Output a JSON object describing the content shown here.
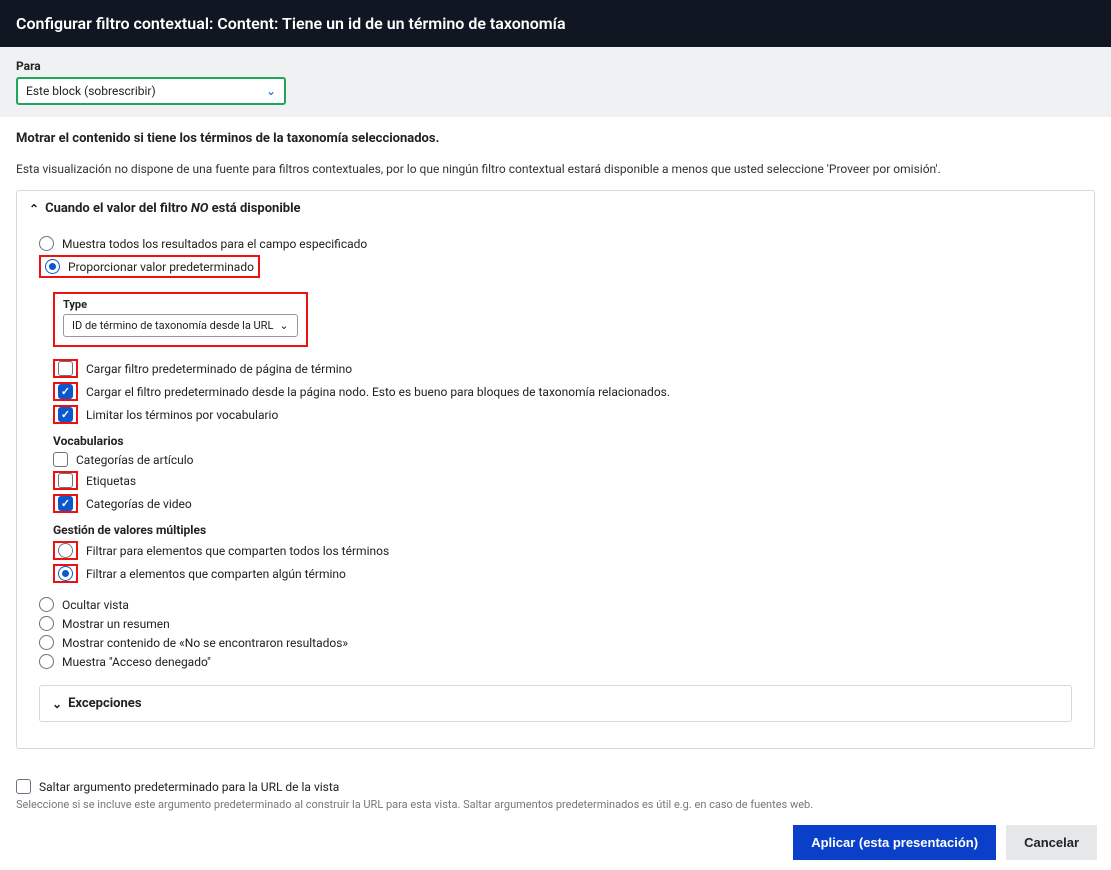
{
  "header": {
    "title": "Configurar filtro contextual: Content: Tiene un id de un término de taxonomía"
  },
  "for_section": {
    "label": "Para",
    "value": "Este block (sobrescribir)"
  },
  "intro": {
    "bold": "Motrar el contenido si tiene los términos de la taxonomía seleccionados.",
    "desc": "Esta visualización no dispone de una fuente para filtros contextuales, por lo que ningún filtro contextual estará disponible a menos que usted seleccione 'Proveer por omisión'."
  },
  "panel_no_filter": {
    "title_pre": "Cuando el valor del filtro ",
    "title_em": "NO",
    "title_post": " está disponible",
    "radios_primary": [
      {
        "label": "Muestra todos los resultados para el campo especificado",
        "checked": false
      },
      {
        "label": "Proporcionar valor predeterminado",
        "checked": true,
        "highlighted": true
      }
    ],
    "type": {
      "label": "Type",
      "value": "ID de término de taxonomía desde la URL"
    },
    "load_checks": [
      {
        "label": "Cargar filtro predeterminado de página de término",
        "checked": false,
        "hl_box": true
      },
      {
        "label": "Cargar el filtro predeterminado desde la página nodo. Esto es bueno para bloques de taxonomía relacionados.",
        "checked": true,
        "hl_box": true
      },
      {
        "label": "Limitar los términos por vocabulario",
        "checked": true,
        "hl_box": true
      }
    ],
    "vocab_heading": "Vocabularios",
    "vocab_checks": [
      {
        "label": "Categorías de artículo",
        "checked": false
      },
      {
        "label": "Etiquetas",
        "checked": false,
        "hl_box": true
      },
      {
        "label": "Categorías de video",
        "checked": true,
        "hl_box": true
      }
    ],
    "multi_heading": "Gestión de valores múltiples",
    "multi_radios": [
      {
        "label": "Filtrar para elementos que comparten todos los términos",
        "checked": false,
        "hl_box": true
      },
      {
        "label": "Filtrar a elementos que comparten algún término",
        "checked": true,
        "hl_box": true
      }
    ],
    "actions": [
      {
        "label": "Ocultar vista",
        "checked": false
      },
      {
        "label": "Mostrar un resumen",
        "checked": false
      },
      {
        "label": "Mostrar contenido de «No se encontraron resultados»",
        "checked": false
      },
      {
        "label": "Muestra \"Acceso denegado\"",
        "checked": false
      }
    ]
  },
  "panel_excepciones": {
    "title": "Excepciones"
  },
  "footer": {
    "skip_label": "Saltar argumento predeterminado para la URL de la vista",
    "skip_note": "Seleccione si se incluve este argumento predeterminado al construir la URL para esta vista. Saltar argumentos predeterminados es útil e.g. en caso de fuentes web."
  },
  "buttons": {
    "apply": "Aplicar (esta presentación)",
    "cancel": "Cancelar"
  }
}
